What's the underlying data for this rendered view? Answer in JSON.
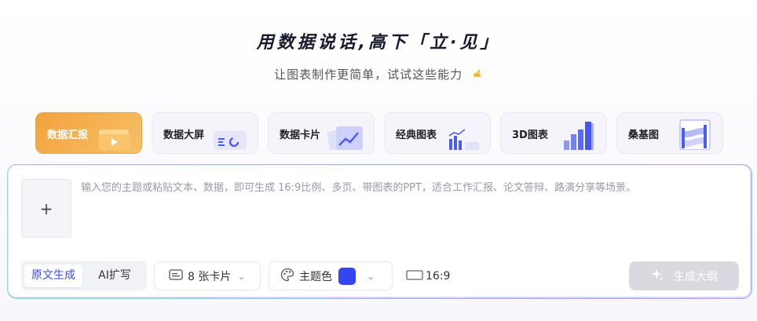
{
  "header": {
    "title": "用数据说话,高下「立·见」",
    "subtitle": "让图表制作更简单，试试这些能力"
  },
  "categories": [
    {
      "label": "数据汇报",
      "icon": "folder-icon",
      "active": true
    },
    {
      "label": "数据大屏",
      "icon": "dashboard-icon",
      "active": false
    },
    {
      "label": "数据卡片",
      "icon": "line-chart-card-icon",
      "active": false
    },
    {
      "label": "经典图表",
      "icon": "bar-chart-icon",
      "active": false
    },
    {
      "label": "3D图表",
      "icon": "3d-bar-icon",
      "active": false
    },
    {
      "label": "桑基图",
      "icon": "sankey-icon",
      "active": false
    }
  ],
  "editor": {
    "upload_symbol": "+",
    "placeholder": "输入您的主题或粘贴文本、数据，即可生成 16:9比例、多页、带图表的PPT，适合工作汇报、论文答辩、路演分享等场景。"
  },
  "toolbar": {
    "mode_original": "原文生成",
    "mode_ai": "AI扩写",
    "card_count": "8 张卡片",
    "theme_label": "主题色",
    "theme_color": "#3346F0",
    "ratio": "16:9",
    "generate_label": "生成大纲"
  },
  "colors": {
    "accent": "#3B4EF0",
    "active_card": "#F2A23C",
    "disabled_button": "#D9D9E0"
  }
}
